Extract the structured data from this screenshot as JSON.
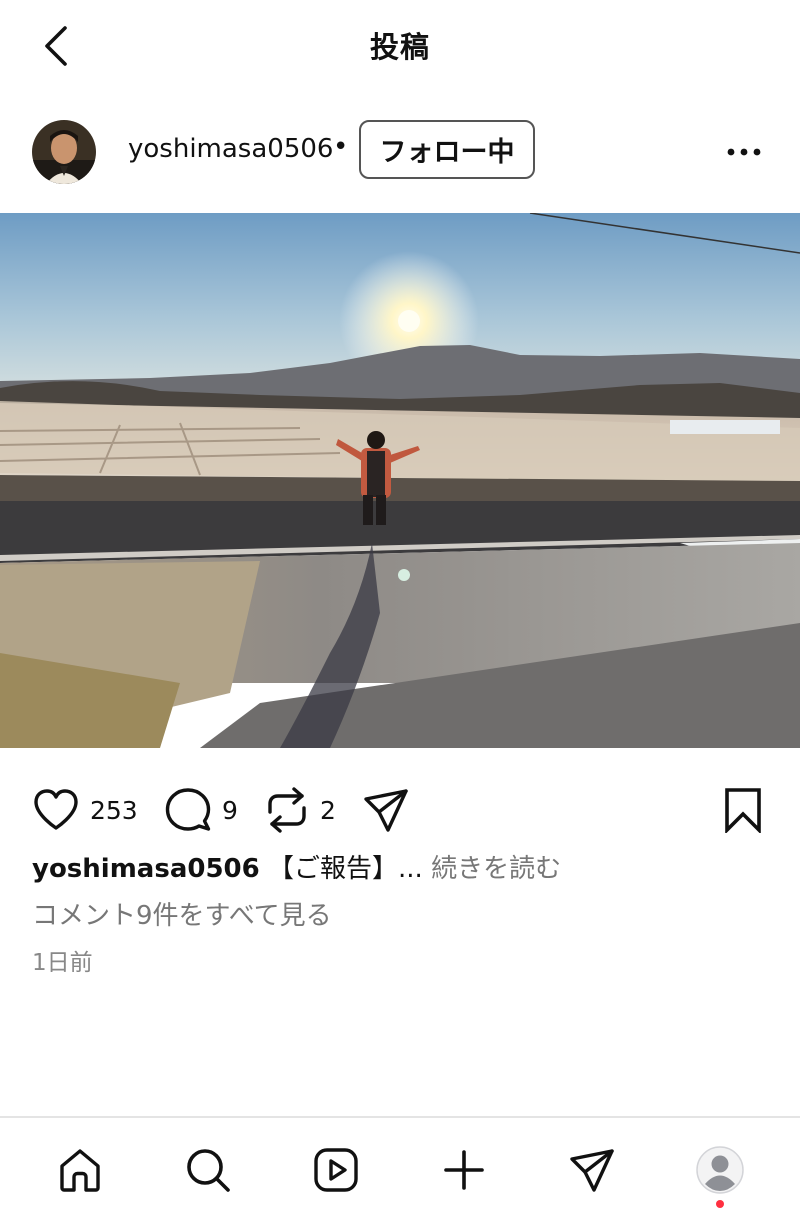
{
  "header": {
    "title": "投稿"
  },
  "post": {
    "username": "yoshimasa0506",
    "separator": "•",
    "follow_label": "フォロー中",
    "likes": "253",
    "comments": "9",
    "reposts": "2",
    "caption_user": "yoshimasa0506",
    "caption_text": "【ご報告】...",
    "more_label": "続きを読む",
    "view_comments": "コメント9件をすべて見る",
    "timestamp": "1日前"
  },
  "icons": {
    "back": "chevron-left-icon",
    "more": "more-horizontal-icon",
    "like": "heart-icon",
    "comment": "comment-icon",
    "repost": "repost-icon",
    "share": "send-icon",
    "save": "bookmark-icon",
    "nav": [
      "home-icon",
      "search-icon",
      "reels-icon",
      "create-icon",
      "messages-icon",
      "profile-icon"
    ]
  },
  "colors": {
    "notification_dot": "#ff3040",
    "secondary_text": "#777777",
    "divider": "#e4e4e4"
  }
}
